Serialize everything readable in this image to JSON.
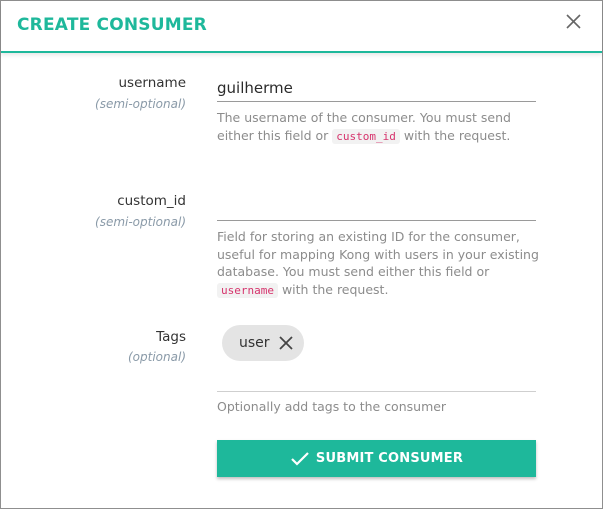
{
  "modal": {
    "title": "CREATE CONSUMER",
    "close_icon": "close-icon"
  },
  "username": {
    "label": "username",
    "sublabel": "(semi-optional)",
    "value": "guilherme",
    "help_before": "The username of the consumer. You must send either this field or ",
    "help_code": "custom_id",
    "help_after": " with the request."
  },
  "custom_id": {
    "label": "custom_id",
    "sublabel": "(semi-optional)",
    "value": "",
    "help_before": "Field for storing an existing ID for the consumer, useful for mapping Kong with users in your existing database. You must send either this field or ",
    "help_code": "username",
    "help_after": " with the request."
  },
  "tags": {
    "label": "Tags",
    "sublabel": "(optional)",
    "items": [
      {
        "label": "user",
        "remove_icon": "close-icon"
      }
    ],
    "help": "Optionally add tags to the consumer"
  },
  "submit": {
    "label": "SUBMIT CONSUMER",
    "icon": "checkmark-icon"
  },
  "colors": {
    "accent": "#1eb89b",
    "code_text": "#d6336c",
    "chip_bg": "#e4e4e4"
  }
}
